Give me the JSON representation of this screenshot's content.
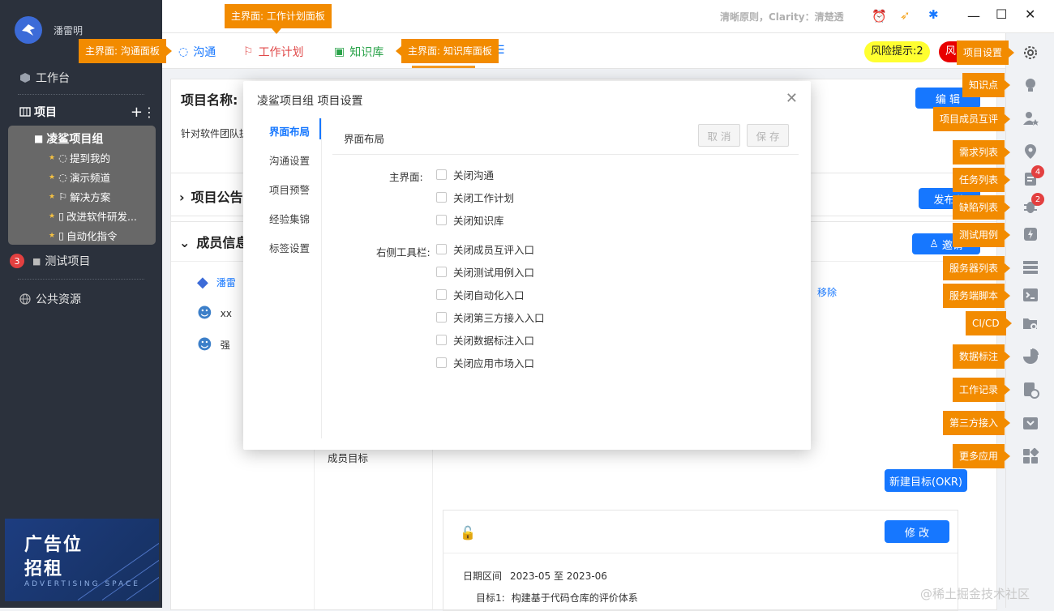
{
  "sidebar": {
    "user_name": "潘雷明",
    "workbench": "工作台",
    "projects_label": "项目",
    "project_group": "凌鲨项目组",
    "project_items": [
      "提到我的",
      "演示频道",
      "解决方案",
      "改进软件研发...",
      "自动化指令"
    ],
    "test_project": "测试项目",
    "test_project_badge": "3",
    "public_resources": "公共资源",
    "ad_line1": "广告位",
    "ad_line2": "招租",
    "ad_line3": "ADVERTISING SPACE"
  },
  "topbar": {
    "clarity_text": "清晰原则，Clarity：清楚透"
  },
  "tabs": {
    "chat": "沟通",
    "plan": "工作计划",
    "kb": "知识库",
    "risk": "风险提示:2",
    "risk2": "风"
  },
  "main": {
    "project_name_label": "项目名称:",
    "project_desc": "针对软件团队提",
    "edit_button": "编 辑",
    "announce_title": "项目公告",
    "publish_button": "发布公",
    "members_title": "成员信息",
    "invite_button": "邀请",
    "members": [
      "潘雷",
      "xx",
      "强"
    ],
    "remove_link": "移除",
    "member_goal": "成员目标",
    "new_okr_button": "新建目标(OKR)",
    "modify_button": "修 改",
    "date_label": "日期区间",
    "date_value": "2023-05 至 2023-06",
    "goal_label": "目标1:",
    "goal_value": "构建基于代码仓库的评价体系"
  },
  "modal": {
    "title": "凌鲨项目组 项目设置",
    "nav": [
      "界面布局",
      "沟通设置",
      "项目预警",
      "经验集锦",
      "标签设置"
    ],
    "section_title": "界面布局",
    "cancel_button": "取 消",
    "save_button": "保 存",
    "main_label": "主界面:",
    "main_options": [
      "关闭沟通",
      "关闭工作计划",
      "关闭知识库"
    ],
    "toolbar_label": "右侧工具栏:",
    "toolbar_options": [
      "关闭成员互评入口",
      "关闭测试用例入口",
      "关闭自动化入口",
      "关闭第三方接入入口",
      "关闭数据标注入口",
      "关闭应用市场入口"
    ]
  },
  "tooltips": {
    "plan_panel": "主界面: 工作计划面板",
    "chat_panel": "主界面: 沟通面板",
    "kb_panel": "主界面: 知识库面板",
    "rail": [
      "项目设置",
      "知识点",
      "项目成员互评",
      "需求列表",
      "任务列表",
      "缺陷列表",
      "测试用例",
      "服务器列表",
      "服务端脚本",
      "CI/CD",
      "数据标注",
      "工作记录",
      "第三方接入",
      "更多应用"
    ]
  },
  "rail_badges": {
    "task": "4",
    "bug": "2"
  },
  "watermark": "@稀土掘金技术社区",
  "colors": {
    "sidebar_bg": "#2b313c",
    "accent": "#1677ff",
    "tooltip": "#f28b00"
  }
}
